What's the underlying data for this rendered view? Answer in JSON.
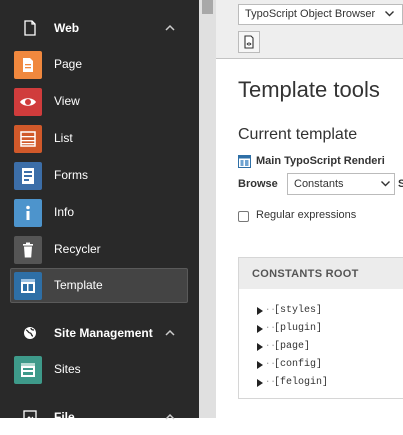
{
  "sidebar": {
    "groups": [
      {
        "label": "Web",
        "icon": "page-icon",
        "modules": [
          {
            "label": "Page",
            "icon": "page-module-icon",
            "color": "#f0883e"
          },
          {
            "label": "View",
            "icon": "eye-icon",
            "color": "#d03c3c"
          },
          {
            "label": "List",
            "icon": "list-icon",
            "color": "#d1592a"
          },
          {
            "label": "Forms",
            "icon": "forms-icon",
            "color": "#3c6ea8"
          },
          {
            "label": "Info",
            "icon": "info-icon",
            "color": "#4d94cc"
          },
          {
            "label": "Recycler",
            "icon": "trash-icon",
            "color": "#555555"
          },
          {
            "label": "Template",
            "icon": "template-icon",
            "color": "#2e6fa6",
            "active": true
          }
        ]
      },
      {
        "label": "Site Management",
        "icon": "globe-icon",
        "modules": [
          {
            "label": "Sites",
            "icon": "sites-icon",
            "color": "#3e9a8a"
          }
        ]
      },
      {
        "label": "File",
        "icon": "file-icon",
        "modules": []
      }
    ]
  },
  "docheader": {
    "function_select": "TypoScript Object Browser"
  },
  "main": {
    "title": "Template tools",
    "subtitle": "Current template",
    "template_name": "Main TypoScript Renderi",
    "browse_label": "Browse",
    "browse_value": "Constants",
    "search_label": "S",
    "regex_label": "Regular expressions",
    "panel_title": "CONSTANTS ROOT",
    "tree": [
      "[styles]",
      "[plugin]",
      "[page]",
      "[config]",
      "[felogin]"
    ]
  }
}
